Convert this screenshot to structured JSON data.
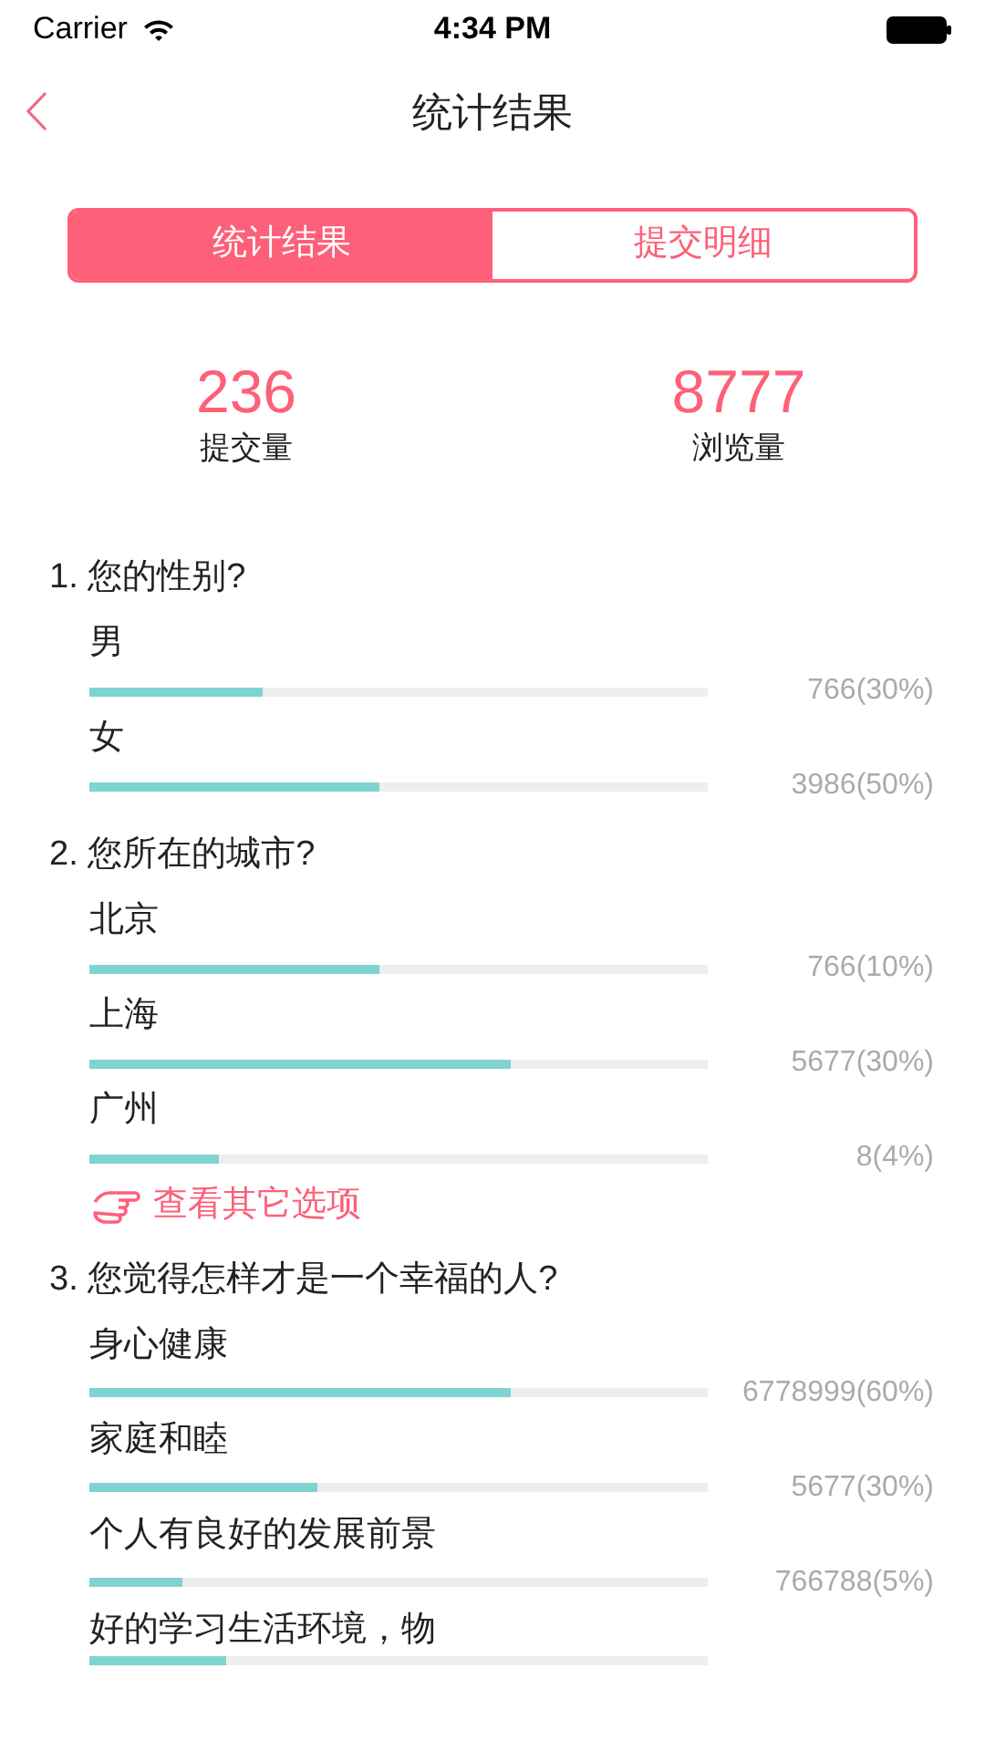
{
  "status_bar": {
    "carrier": "Carrier",
    "time": "4:34 PM"
  },
  "nav": {
    "title": "统计结果"
  },
  "tabs": [
    {
      "label": "统计结果",
      "selected": true
    },
    {
      "label": "提交明细",
      "selected": false
    }
  ],
  "stats": [
    {
      "value": "236",
      "label": "提交量"
    },
    {
      "value": "8777",
      "label": "浏览量"
    }
  ],
  "questions": [
    {
      "title": "1. 您的性别?",
      "options": [
        {
          "label": "男",
          "level": 0.28,
          "reading": "766(30%)"
        },
        {
          "label": "女",
          "level": 0.47,
          "reading": "3986(50%)"
        }
      ]
    },
    {
      "title": "2. 您所在的城市?",
      "options": [
        {
          "label": "北京",
          "level": 0.47,
          "reading": "766(10%)"
        },
        {
          "label": "上海",
          "level": 0.68,
          "reading": "5677(30%)"
        },
        {
          "label": "广州",
          "level": 0.21,
          "reading": "8(4%)"
        }
      ],
      "more_link": "查看其它选项"
    },
    {
      "title": "3. 您觉得怎样才是一个幸福的人?",
      "options": [
        {
          "label": "身心健康",
          "level": 0.68,
          "reading": "6778999(60%)"
        },
        {
          "label": "家庭和睦",
          "level": 0.37,
          "reading": "5677(30%)"
        },
        {
          "label": "个人有良好的发展前景",
          "level": 0.15,
          "reading": "766788(5%)"
        },
        {
          "label": "好的学习生活环境，物",
          "level": 0.22
        }
      ]
    }
  ]
}
